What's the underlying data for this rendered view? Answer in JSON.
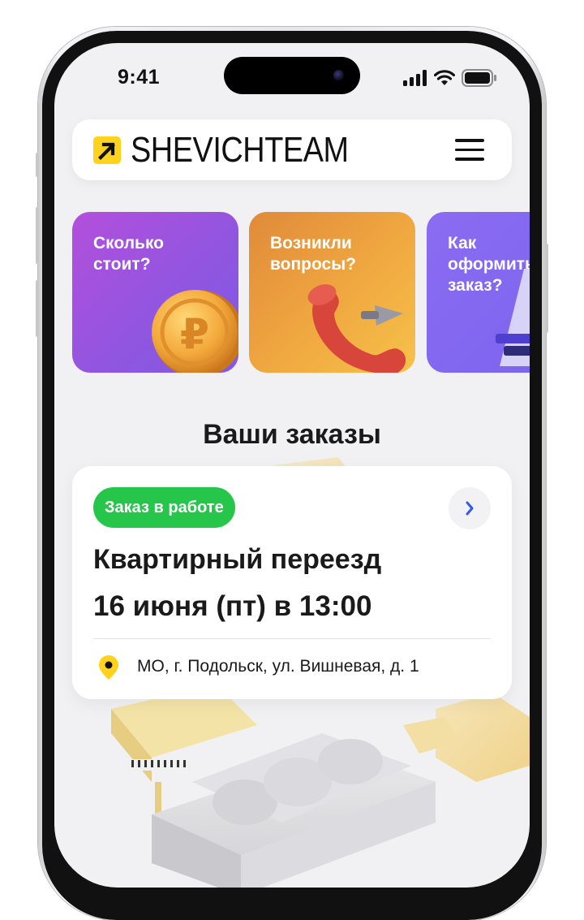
{
  "status_bar": {
    "time": "9:41"
  },
  "header": {
    "brand": "SHEVICHTEAM"
  },
  "promo_cards": [
    {
      "label": "Сколько\nстоит?"
    },
    {
      "label": "Возникли\nвопросы?"
    },
    {
      "label": "Как\nоформить\nзаказ?"
    }
  ],
  "orders": {
    "title": "Ваши заказы",
    "items": [
      {
        "status": "Заказ в работе",
        "title": "Квартирный переезд",
        "datetime": "16 июня (пт) в 13:00",
        "address": "МО, г. Подольск, ул. Вишневая, д. 1"
      }
    ]
  },
  "colors": {
    "status_green": "#26C64B",
    "brand_yellow": "#FFD21E",
    "arrow_blue": "#2F5BE8"
  },
  "icons": [
    "logo-arrow-icon",
    "menu-icon",
    "chevron-right-icon",
    "location-pin-icon",
    "signal-icon",
    "wifi-icon",
    "battery-icon"
  ]
}
